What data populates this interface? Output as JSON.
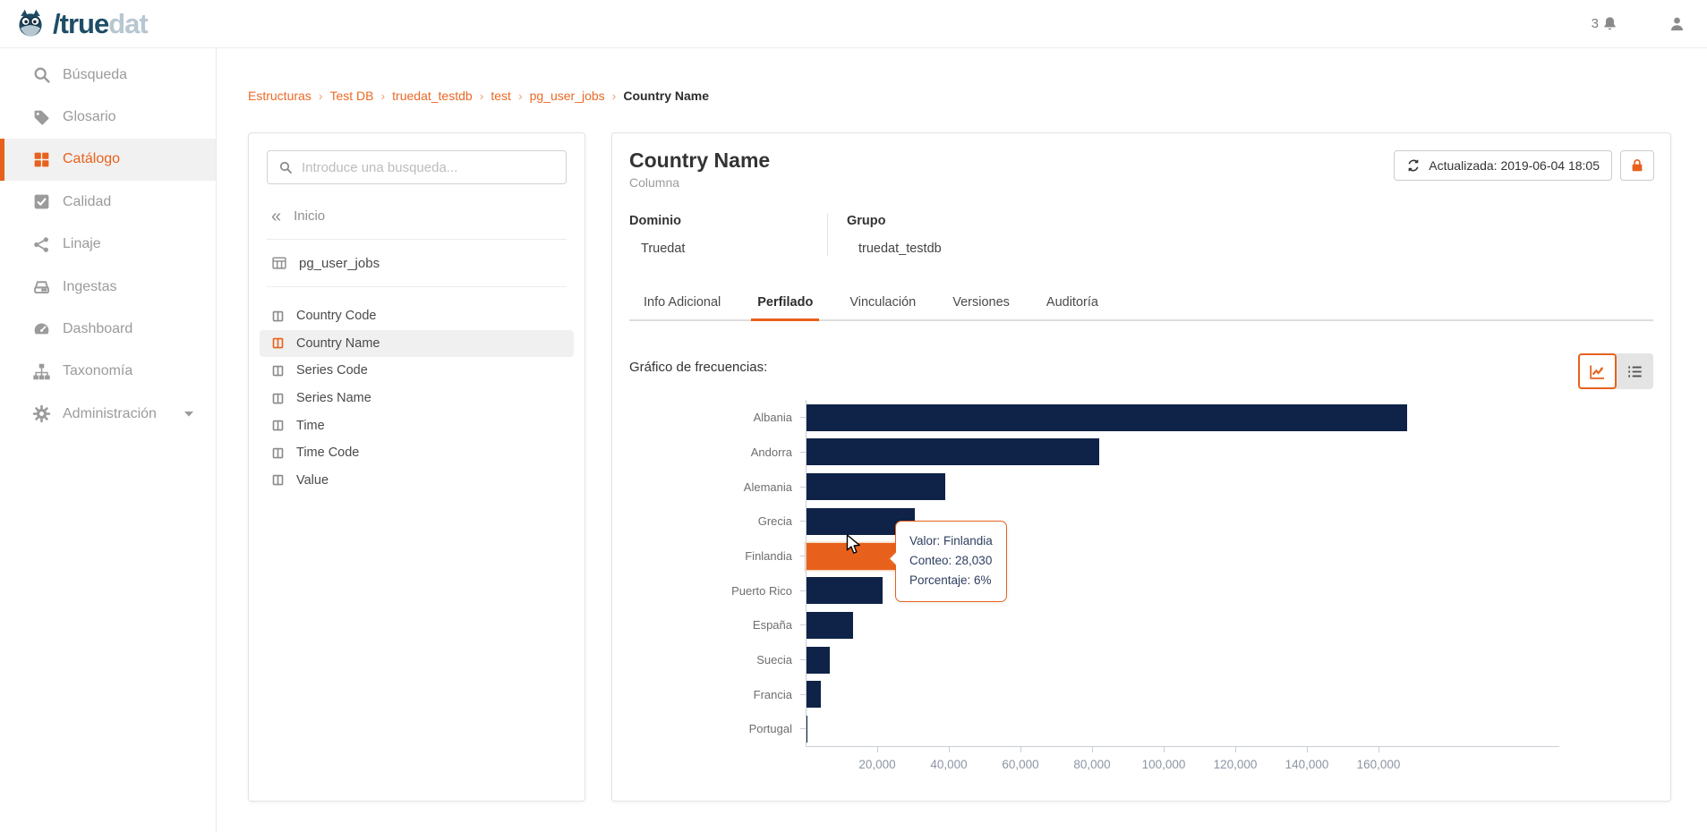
{
  "theme": {
    "accent": "#e8611c",
    "bar_navy": "#0e2347",
    "logo_dark": "#1e4d66",
    "logo_light": "#b6c7d1"
  },
  "header": {
    "logo_slash": "/",
    "logo_primary": "true",
    "logo_secondary": "dat",
    "notification_count": "3"
  },
  "sidebar": {
    "items": [
      {
        "label": "Búsqueda",
        "icon": "search-icon",
        "active": false
      },
      {
        "label": "Glosario",
        "icon": "tags-icon",
        "active": false
      },
      {
        "label": "Catálogo",
        "icon": "grid-icon",
        "active": true
      },
      {
        "label": "Calidad",
        "icon": "check-square-icon",
        "active": false
      },
      {
        "label": "Linaje",
        "icon": "share-icon",
        "active": false
      },
      {
        "label": "Ingestas",
        "icon": "drive-icon",
        "active": false
      },
      {
        "label": "Dashboard",
        "icon": "gauge-icon",
        "active": false
      },
      {
        "label": "Taxonomía",
        "icon": "sitemap-icon",
        "active": false
      },
      {
        "label": "Administración",
        "icon": "gear-icon",
        "active": false,
        "has_submenu": true
      }
    ]
  },
  "breadcrumb": {
    "links": [
      "Estructuras",
      "Test DB",
      "truedat_testdb",
      "test",
      "pg_user_jobs"
    ],
    "separator": "›",
    "current": "Country Name"
  },
  "tree_panel": {
    "search_placeholder": "Introduce una busqueda...",
    "back_label": "Inicio",
    "table_name": "pg_user_jobs",
    "columns": [
      "Country Code",
      "Country Name",
      "Series Code",
      "Series Name",
      "Time",
      "Time Code",
      "Value"
    ],
    "selected_column": "Country Name"
  },
  "detail": {
    "title": "Country Name",
    "subtitle": "Columna",
    "updated_label": "Actualizada: 2019-06-04 18:05",
    "fields": [
      {
        "label": "Dominio",
        "value": "Truedat"
      },
      {
        "label": "Grupo",
        "value": "truedat_testdb"
      }
    ],
    "tabs": [
      "Info Adicional",
      "Perfilado",
      "Vinculación",
      "Versiones",
      "Auditoría"
    ],
    "active_tab": "Perfilado",
    "section_title": "Gráfico de frecuencias:"
  },
  "tooltip": {
    "lines": [
      "Valor: Finlandia",
      "Conteo: 28,030",
      "Porcentaje: 6%"
    ]
  },
  "chart_data": {
    "type": "bar",
    "orientation": "horizontal",
    "title": "Gráfico de frecuencias",
    "categories": [
      "Albania",
      "Andorra",
      "Alemania",
      "Grecia",
      "Finlandia",
      "Puerto Rico",
      "España",
      "Suecia",
      "Francia",
      "Portugal"
    ],
    "values": [
      168000,
      82000,
      39000,
      30500,
      28030,
      21500,
      13300,
      6800,
      4300,
      500
    ],
    "highlight": {
      "category": "Finlandia",
      "valor": "Finlandia",
      "conteo": "28,030",
      "porcentaje": "6%"
    },
    "x_ticks": [
      20000,
      40000,
      60000,
      80000,
      100000,
      120000,
      140000,
      160000
    ],
    "x_tick_labels": [
      "20,000",
      "40,000",
      "60,000",
      "80,000",
      "100,000",
      "120,000",
      "140,000",
      "160,000"
    ],
    "xlim": [
      0,
      210000
    ],
    "grid": false,
    "legend": false,
    "bar_color": "#0e2347",
    "highlight_color": "#e8611c"
  }
}
